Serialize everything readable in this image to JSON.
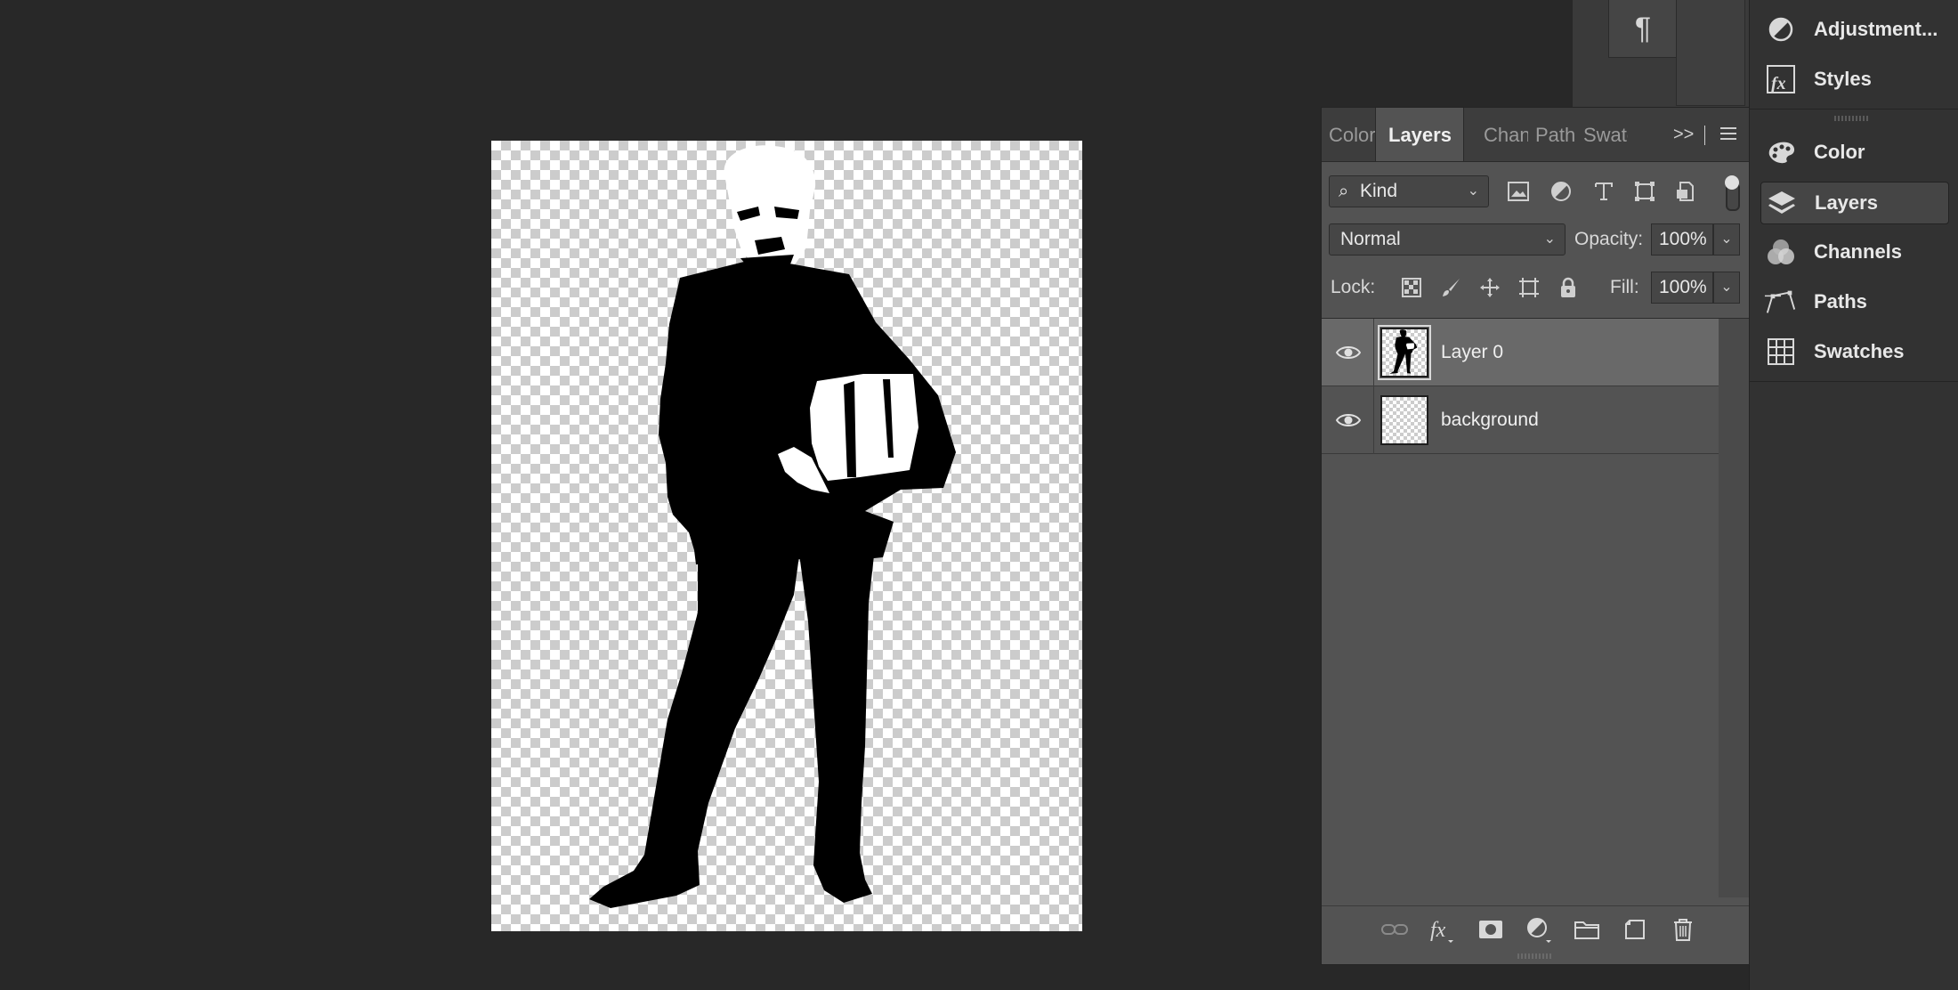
{
  "layers_panel": {
    "tabs": [
      {
        "label": "Color",
        "active": false
      },
      {
        "label": "Layers",
        "active": true
      },
      {
        "label": "Channels",
        "active": false
      },
      {
        "label": "Paths",
        "active": false
      },
      {
        "label": "Swatches",
        "active": false
      }
    ],
    "more_glyph": ">>",
    "filter": {
      "value": "Kind",
      "icon": "search-icon"
    },
    "blend_mode": "Normal",
    "opacity_label": "Opacity:",
    "opacity_value": "100%",
    "lock_label": "Lock:",
    "fill_label": "Fill:",
    "fill_value": "100%",
    "layers": [
      {
        "name": "Layer 0",
        "visible": true,
        "selected": true
      },
      {
        "name": "background",
        "visible": true,
        "selected": false
      }
    ]
  },
  "right_dock": {
    "items": [
      {
        "label": "Adjustment...",
        "icon": "adjustments-icon"
      },
      {
        "label": "Styles",
        "icon": "styles-fx-icon"
      },
      {
        "label": "Color",
        "icon": "color-palette-icon"
      },
      {
        "label": "Layers",
        "icon": "layers-icon",
        "active": true
      },
      {
        "label": "Channels",
        "icon": "channels-icon"
      },
      {
        "label": "Paths",
        "icon": "paths-icon"
      },
      {
        "label": "Swatches",
        "icon": "swatches-icon"
      }
    ]
  },
  "mini_dock": {
    "paragraph_glyph": "¶"
  },
  "colors": {
    "workspace": "#282828",
    "panel": "#535353",
    "selected_row": "#696969"
  }
}
